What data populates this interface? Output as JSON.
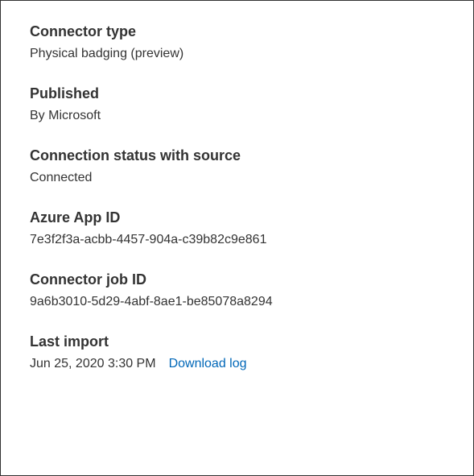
{
  "connector_type": {
    "label": "Connector type",
    "value": "Physical badging (preview)"
  },
  "published": {
    "label": "Published",
    "value": "By Microsoft"
  },
  "connection_status": {
    "label": "Connection status with source",
    "value": "Connected"
  },
  "azure_app_id": {
    "label": "Azure App ID",
    "value": "7e3f2f3a-acbb-4457-904a-c39b82c9e861"
  },
  "connector_job_id": {
    "label": "Connector job ID",
    "value": "9a6b3010-5d29-4abf-8ae1-be85078a8294"
  },
  "last_import": {
    "label": "Last import",
    "value": "Jun 25, 2020 3:30 PM",
    "download_link": "Download log"
  }
}
